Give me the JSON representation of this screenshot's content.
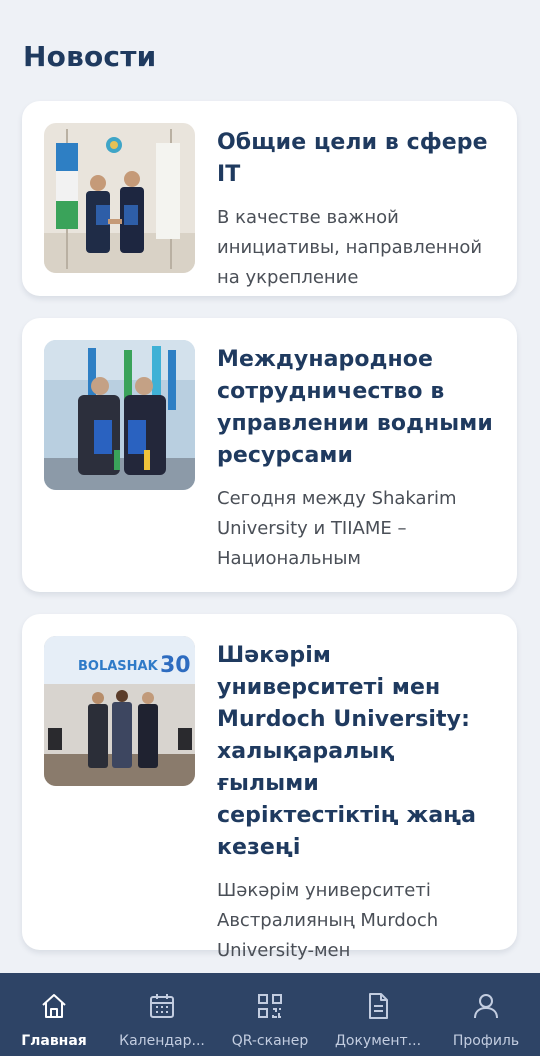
{
  "header": {
    "title": "Новости"
  },
  "news": [
    {
      "title": "Общие цели в сфере IT",
      "excerpt": "В качестве важной инициативы, направленной на укрепление"
    },
    {
      "title": "Международное сотрудничество в управлении водными ресурсами",
      "excerpt": "Сегодня между Shakarim University и TIIAME – Национальным"
    },
    {
      "title": "Шәкәрім университеті мен Murdoch University: халықаралық ғылыми серіктестіктің жаңа кезеңі",
      "excerpt": "Шәкәрім университеті Австралияның Murdoch University-мен",
      "image_banner": {
        "text": "BOLASHAK",
        "number": "30"
      }
    }
  ],
  "bottom_nav": [
    {
      "label": "Главная",
      "icon": "home-icon",
      "active": true
    },
    {
      "label": "Календар...",
      "icon": "calendar-icon",
      "active": false
    },
    {
      "label": "QR-сканер",
      "icon": "qr-code-icon",
      "active": false
    },
    {
      "label": "Документ...",
      "icon": "document-icon",
      "active": false
    },
    {
      "label": "Профиль",
      "icon": "profile-icon",
      "active": false
    }
  ],
  "colors": {
    "background": "#eef1f6",
    "card": "#ffffff",
    "title": "#1f3a5f",
    "nav_bar": "#2e4466",
    "nav_label": "#c3cde0"
  }
}
